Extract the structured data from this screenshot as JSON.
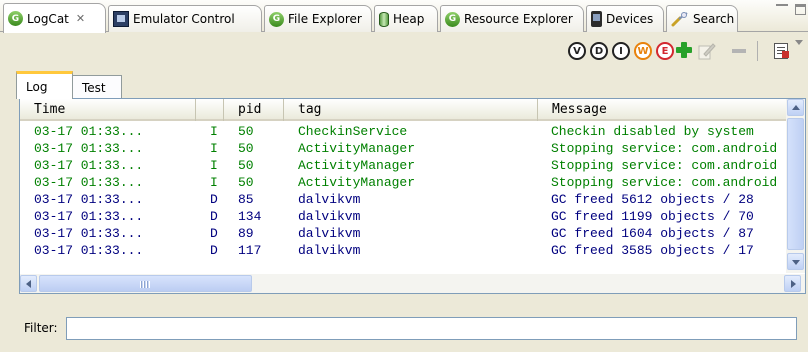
{
  "view_tabs": [
    {
      "label": "LogCat",
      "icon": "ddms-logcat-icon",
      "active": true,
      "closable": true
    },
    {
      "label": "Emulator Control",
      "icon": "emulator-control-icon"
    },
    {
      "label": "File Explorer",
      "icon": "ddms-file-explorer-icon"
    },
    {
      "label": "Heap",
      "icon": "heap-icon"
    },
    {
      "label": "Resource Explorer",
      "icon": "ddms-resource-explorer-icon"
    },
    {
      "label": "Devices",
      "icon": "device-icon"
    },
    {
      "label": "Search",
      "icon": "search-icon"
    }
  ],
  "toolbar": {
    "levels": [
      {
        "letter": "V",
        "name": "verbose"
      },
      {
        "letter": "D",
        "name": "debug"
      },
      {
        "letter": "I",
        "name": "info"
      },
      {
        "letter": "W",
        "name": "warning",
        "color": "#e8820c"
      },
      {
        "letter": "E",
        "name": "error",
        "color": "#d3282f"
      }
    ],
    "add_filter_color": "#27a12a"
  },
  "sub_tabs": [
    {
      "label": "Log",
      "active": true
    },
    {
      "label": "Test"
    }
  ],
  "table": {
    "columns": [
      "Time",
      "",
      "pid",
      "tag",
      "Message"
    ],
    "rows": [
      {
        "time": "03-17 01:33...",
        "level": "I",
        "pid": "50",
        "tag": "CheckinService",
        "message": "Checkin disabled by system"
      },
      {
        "time": "03-17 01:33...",
        "level": "I",
        "pid": "50",
        "tag": "ActivityManager",
        "message": "Stopping service: com.android"
      },
      {
        "time": "03-17 01:33...",
        "level": "I",
        "pid": "50",
        "tag": "ActivityManager",
        "message": "Stopping service: com.android"
      },
      {
        "time": "03-17 01:33...",
        "level": "I",
        "pid": "50",
        "tag": "ActivityManager",
        "message": "Stopping service: com.android"
      },
      {
        "time": "03-17 01:33...",
        "level": "D",
        "pid": "85",
        "tag": "dalvikvm",
        "message": "GC freed 5612 objects / 28"
      },
      {
        "time": "03-17 01:33...",
        "level": "D",
        "pid": "134",
        "tag": "dalvikvm",
        "message": "GC freed 1199 objects / 70"
      },
      {
        "time": "03-17 01:33...",
        "level": "D",
        "pid": "89",
        "tag": "dalvikvm",
        "message": "GC freed 1604 objects / 87"
      },
      {
        "time": "03-17 01:33...",
        "level": "D",
        "pid": "117",
        "tag": "dalvikvm",
        "message": "GC freed 3585 objects / 17"
      }
    ],
    "level_colors": {
      "I": "#008000",
      "D": "#00007f"
    }
  },
  "filter": {
    "label": "Filter:",
    "value": "",
    "placeholder": ""
  }
}
